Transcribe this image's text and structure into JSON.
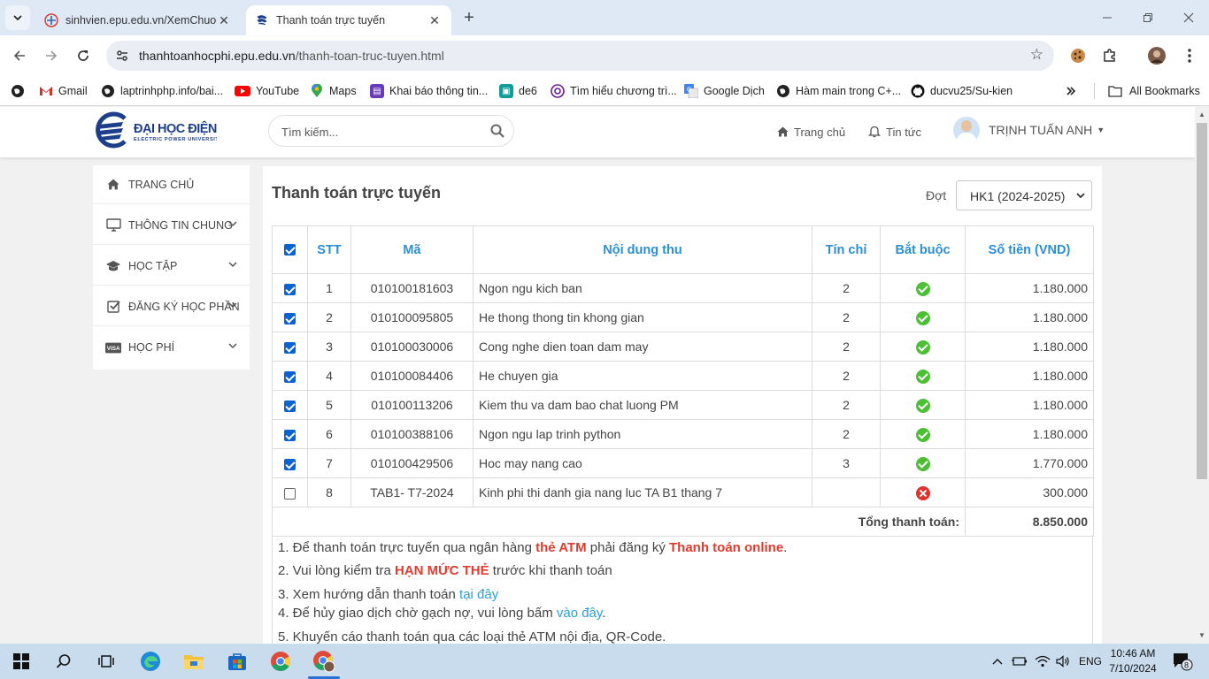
{
  "browser": {
    "tabs": [
      {
        "title": "sinhvien.epu.edu.vn/XemChuong"
      },
      {
        "title": "Thanh toán trực tuyến"
      }
    ],
    "url_host": "thanhtoanhocphi.epu.edu.vn",
    "url_path": "/thanh-toan-truc-tuyen.html",
    "bookmarks": [
      "Gmail",
      "laptrinhphp.info/bai...",
      "YouTube",
      "Maps",
      "Khai báo thông tin...",
      "de6",
      "Tìm hiểu chương trì...",
      "Google Dịch",
      "Hàm main trong C+...",
      "ducvu25/Su-kien"
    ],
    "all_bookmarks": "All Bookmarks"
  },
  "header": {
    "search_placeholder": "Tìm kiếm...",
    "nav_home": "Trang chủ",
    "nav_news": "Tin tức",
    "user_name": "TRỊNH TUẤN ANH"
  },
  "sidebar": {
    "items": [
      {
        "label": "TRANG CHỦ",
        "icon": "home-icon"
      },
      {
        "label": "THÔNG TIN CHUNG",
        "icon": "monitor-icon"
      },
      {
        "label": "HỌC TẬP",
        "icon": "graduation-cap-icon"
      },
      {
        "label": "ĐĂNG KÝ HỌC PHẦN",
        "icon": "checkbox-icon"
      },
      {
        "label": "HỌC PHÍ",
        "icon": "visa-card-icon"
      }
    ]
  },
  "main": {
    "title": "Thanh toán trực tuyến",
    "period_label": "Đợt",
    "period_value": "HK1 (2024-2025)",
    "columns": [
      "STT",
      "Mã",
      "Nội dung thu",
      "Tín chỉ",
      "Bắt buộc",
      "Số tiền (VND)"
    ],
    "rows": [
      {
        "checked": true,
        "stt": "1",
        "code": "010100181603",
        "content": "Ngon ngu kich ban",
        "credits": "2",
        "required": true,
        "amount": "1.180.000"
      },
      {
        "checked": true,
        "stt": "2",
        "code": "010100095805",
        "content": "He thong thong tin khong gian",
        "credits": "2",
        "required": true,
        "amount": "1.180.000"
      },
      {
        "checked": true,
        "stt": "3",
        "code": "010100030006",
        "content": "Cong nghe dien toan dam may",
        "credits": "2",
        "required": true,
        "amount": "1.180.000"
      },
      {
        "checked": true,
        "stt": "4",
        "code": "010100084406",
        "content": "He chuyen gia",
        "credits": "2",
        "required": true,
        "amount": "1.180.000"
      },
      {
        "checked": true,
        "stt": "5",
        "code": "010100113206",
        "content": "Kiem thu va dam bao chat luong PM",
        "credits": "2",
        "required": true,
        "amount": "1.180.000"
      },
      {
        "checked": true,
        "stt": "6",
        "code": "010100388106",
        "content": "Ngon ngu lap trinh python",
        "credits": "2",
        "required": true,
        "amount": "1.180.000"
      },
      {
        "checked": true,
        "stt": "7",
        "code": "010100429506",
        "content": "Hoc may nang cao",
        "credits": "3",
        "required": true,
        "amount": "1.770.000"
      },
      {
        "checked": false,
        "stt": "8",
        "code": "TAB1- T7-2024",
        "content": "Kinh phi thi danh gia nang luc TA B1 thang 7",
        "credits": "",
        "required": false,
        "amount": "300.000"
      }
    ],
    "total_label": "Tổng thanh toán:",
    "total_value": "8.850.000",
    "notes": {
      "n1_a": "1. Để thanh toán trực tuyến qua ngân hàng ",
      "n1_b": "thẻ ATM",
      "n1_c": " phải đăng ký ",
      "n1_d": "Thanh toán online",
      "n1_e": ".",
      "n2_a": "2. Vui lòng kiểm tra ",
      "n2_b": "HẠN MỨC THẺ",
      "n2_c": " trước khi thanh toán",
      "n3_a": "3. Xem hướng dẫn thanh toán ",
      "n3_link": "tại đây",
      "n4_a": "4. Để hủy giao dịch chờ gạch nợ, vui lòng bấm ",
      "n4_link": "vào đây",
      "n4_c": ".",
      "n5": "5. Khuyến cáo thanh toán qua các loại thẻ ATM nội địa, QR-Code."
    }
  },
  "taskbar": {
    "lang": "ENG",
    "time": "10:46 AM",
    "date": "7/10/2024",
    "notification_count": "8"
  },
  "colors": {
    "accent_blue": "#2a8fd8",
    "warning_red": "#e23a2e",
    "check_green": "#4cbf34"
  }
}
